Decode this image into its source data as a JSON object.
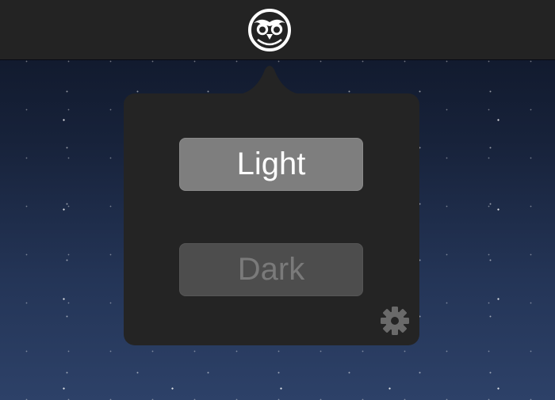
{
  "menu_bar": {
    "status_icon": "owl-icon"
  },
  "popover": {
    "buttons": [
      {
        "label": "Light",
        "state": "selected"
      },
      {
        "label": "Dark",
        "state": "unselected"
      }
    ],
    "settings_icon": "gear-icon"
  },
  "colors": {
    "menu_bar": "#232323",
    "popover": "#242424",
    "light_button": "#7e7e7e",
    "dark_button": "#4d4d4d",
    "dark_label": "#7a7a7a",
    "gear": "#6a6a6a"
  }
}
